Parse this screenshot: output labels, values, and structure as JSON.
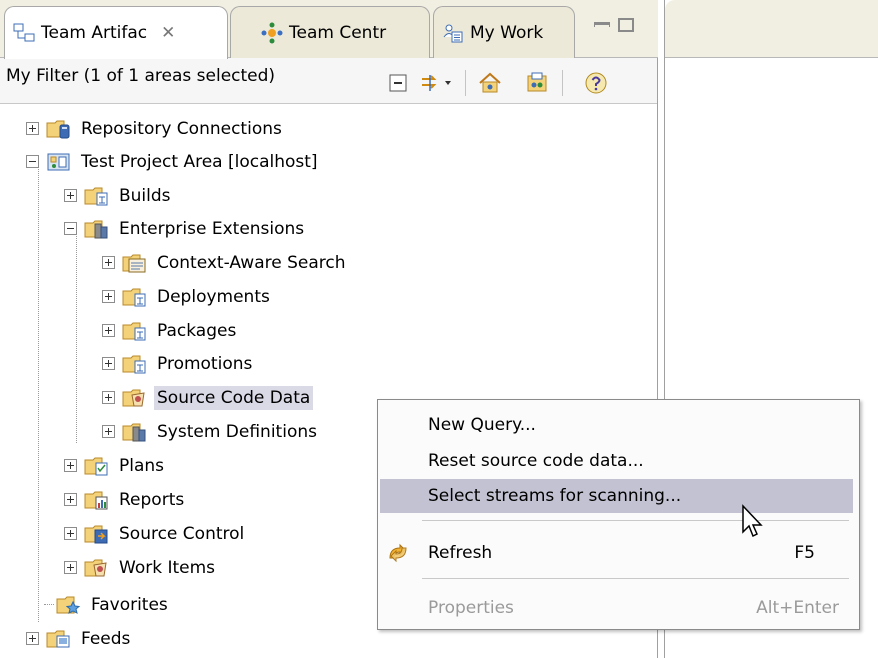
{
  "tabs": [
    {
      "label": "Team Artifac",
      "close": "✕",
      "icon": "team-artifacts-icon"
    },
    {
      "label": "Team Centr",
      "icon": "team-central-icon"
    },
    {
      "label": "My Work",
      "icon": "my-work-icon"
    }
  ],
  "filter": {
    "label": "My Filter (1 of 1 areas selected)"
  },
  "tree": [
    {
      "label": "Repository Connections",
      "icon": "repository-connections-icon"
    },
    {
      "label": "Test Project Area [localhost]",
      "icon": "project-area-icon"
    },
    {
      "label": "Builds",
      "icon": "builds-folder-icon"
    },
    {
      "label": "Enterprise Extensions",
      "icon": "enterprise-extensions-icon"
    },
    {
      "label": "Context-Aware Search",
      "icon": "context-aware-search-icon"
    },
    {
      "label": "Deployments",
      "icon": "deployments-folder-icon"
    },
    {
      "label": "Packages",
      "icon": "packages-folder-icon"
    },
    {
      "label": "Promotions",
      "icon": "promotions-folder-icon"
    },
    {
      "label": "Source Code Data",
      "icon": "source-code-data-icon"
    },
    {
      "label": "System Definitions",
      "icon": "system-definitions-icon"
    },
    {
      "label": "Plans",
      "icon": "plans-folder-icon"
    },
    {
      "label": "Reports",
      "icon": "reports-folder-icon"
    },
    {
      "label": "Source Control",
      "icon": "source-control-folder-icon"
    },
    {
      "label": "Work Items",
      "icon": "work-items-folder-icon"
    },
    {
      "label": "Favorites",
      "icon": "favorites-folder-icon"
    },
    {
      "label": "Feeds",
      "icon": "feeds-folder-icon"
    }
  ],
  "context_menu": {
    "items": [
      {
        "label": "New Query..."
      },
      {
        "label": "Reset source code data..."
      },
      {
        "label": "Select streams for scanning..."
      },
      {
        "label": "Refresh",
        "shortcut": "F5",
        "icon": "refresh-icon"
      },
      {
        "label": "Properties",
        "shortcut": "Alt+Enter"
      }
    ]
  },
  "colors": {
    "selection": "#dad9e6",
    "menu_highlight": "#c2c2d2",
    "folder_yellow": "#f3d27a"
  }
}
